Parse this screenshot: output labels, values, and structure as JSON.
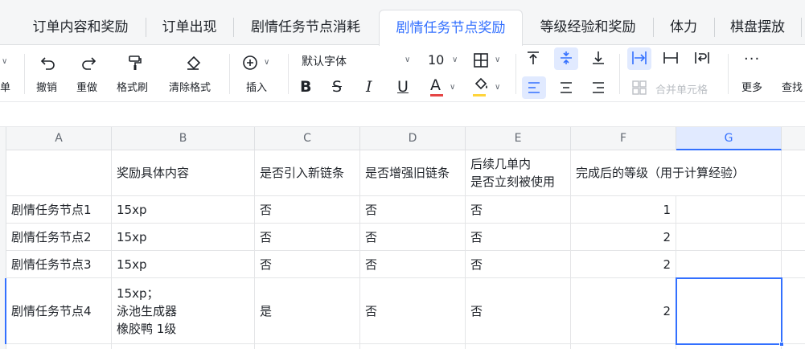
{
  "tabs": [
    {
      "label": "订单内容和奖励",
      "active": false
    },
    {
      "label": "订单出现",
      "active": false
    },
    {
      "label": "剧情任务节点消耗",
      "active": false
    },
    {
      "label": "剧情任务节点奖励",
      "active": true
    },
    {
      "label": "等级经验和奖励",
      "active": false
    },
    {
      "label": "体力",
      "active": false
    },
    {
      "label": "棋盘摆放",
      "active": false
    }
  ],
  "toolbar": {
    "partial_left": "单",
    "undo": "撤销",
    "redo": "重做",
    "format_painter": "格式刷",
    "clear_format": "清除格式",
    "insert": "插入",
    "font_name": "默认字体",
    "font_size": "10",
    "merge_cells": "合并单元格",
    "more": "更多",
    "find": "查找"
  },
  "columns": [
    "A",
    "B",
    "C",
    "D",
    "E",
    "F",
    "G"
  ],
  "rows": [
    [
      "",
      "奖励具体内容",
      "是否引入新链条",
      "是否增强旧链条",
      "后续几单内\n是否立刻被使用",
      "完成后的等级（用于计算经验）",
      ""
    ],
    [
      "剧情任务节点1",
      "15xp",
      "否",
      "否",
      "否",
      "1",
      ""
    ],
    [
      "剧情任务节点2",
      "15xp",
      "否",
      "否",
      "否",
      "2",
      ""
    ],
    [
      "剧情任务节点3",
      "15xp",
      "否",
      "否",
      "否",
      "2",
      ""
    ],
    [
      "剧情任务节点4",
      "15xp；\n泳池生成器\n橡胶鸭 1级",
      "是",
      "否",
      "否",
      "2",
      ""
    ]
  ],
  "selected_column": "G",
  "accent_color": "#3370ff"
}
